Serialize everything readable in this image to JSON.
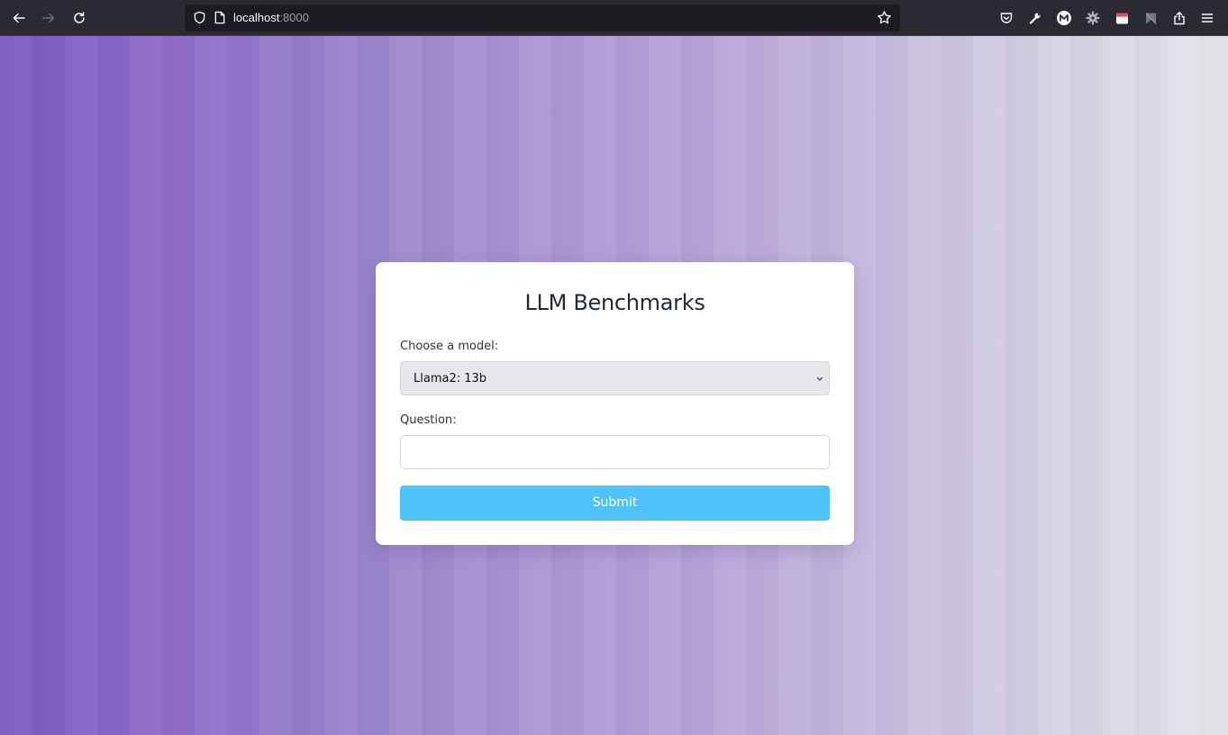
{
  "browser": {
    "url_host": "localhost",
    "url_port": ":8000",
    "toolbar_icons": [
      "pocket-icon",
      "wrench-icon",
      "m-extension-icon",
      "gear-extension-icon",
      "calendar-extension-icon",
      "flag-extension-icon",
      "share-icon",
      "menu-icon"
    ]
  },
  "form": {
    "title": "LLM Benchmarks",
    "model_label": "Choose a model:",
    "model_selected": "Llama2: 13b",
    "question_label": "Question:",
    "question_value": "",
    "submit_label": "Submit"
  },
  "colors": {
    "gradient_left": "#7d5bbf",
    "gradient_right": "#e7e7ed",
    "submit_button": "#4fc3f7",
    "select_background": "#e7e6eb"
  }
}
